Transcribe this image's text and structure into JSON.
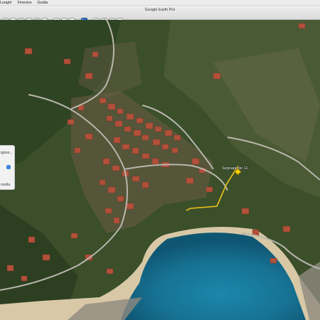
{
  "menubar": {
    "items": [
      "Luoghi",
      "Finestra",
      "Guida"
    ]
  },
  "window": {
    "title": "Google Earth Pro"
  },
  "toolbar": {
    "buttons": [
      {
        "icon": "sidebar-icon",
        "glyph": "▤"
      },
      {
        "icon": "placemark-icon",
        "glyph": "⌖"
      },
      {
        "icon": "polygon-icon",
        "glyph": "⬠"
      },
      {
        "icon": "path-icon",
        "glyph": "〜"
      },
      {
        "icon": "overlay-icon",
        "glyph": "▦"
      },
      {
        "icon": "tour-icon",
        "glyph": "●"
      },
      {
        "icon": "history-icon",
        "glyph": "◷"
      },
      {
        "icon": "sun-icon",
        "glyph": "☼"
      },
      {
        "icon": "planets-icon",
        "glyph": "◒"
      },
      {
        "icon": "ruler-icon",
        "glyph": "⊢"
      },
      {
        "icon": "email-icon",
        "glyph": "✉"
      },
      {
        "icon": "print-icon",
        "glyph": "⎙"
      },
      {
        "icon": "save-image-icon",
        "glyph": "▣"
      },
      {
        "icon": "maps-icon",
        "glyph": "◈"
      }
    ]
  },
  "panel": {
    "text_top": "igono...",
    "text_bottom": "ncella"
  },
  "placemark": {
    "label": "Segnaposto 11"
  },
  "colors": {
    "water": "#1f7fa3",
    "beach": "#d8c8a6",
    "vegetation": "#3a5228",
    "roofs": "#b2503a",
    "path": "#f0c21d"
  }
}
